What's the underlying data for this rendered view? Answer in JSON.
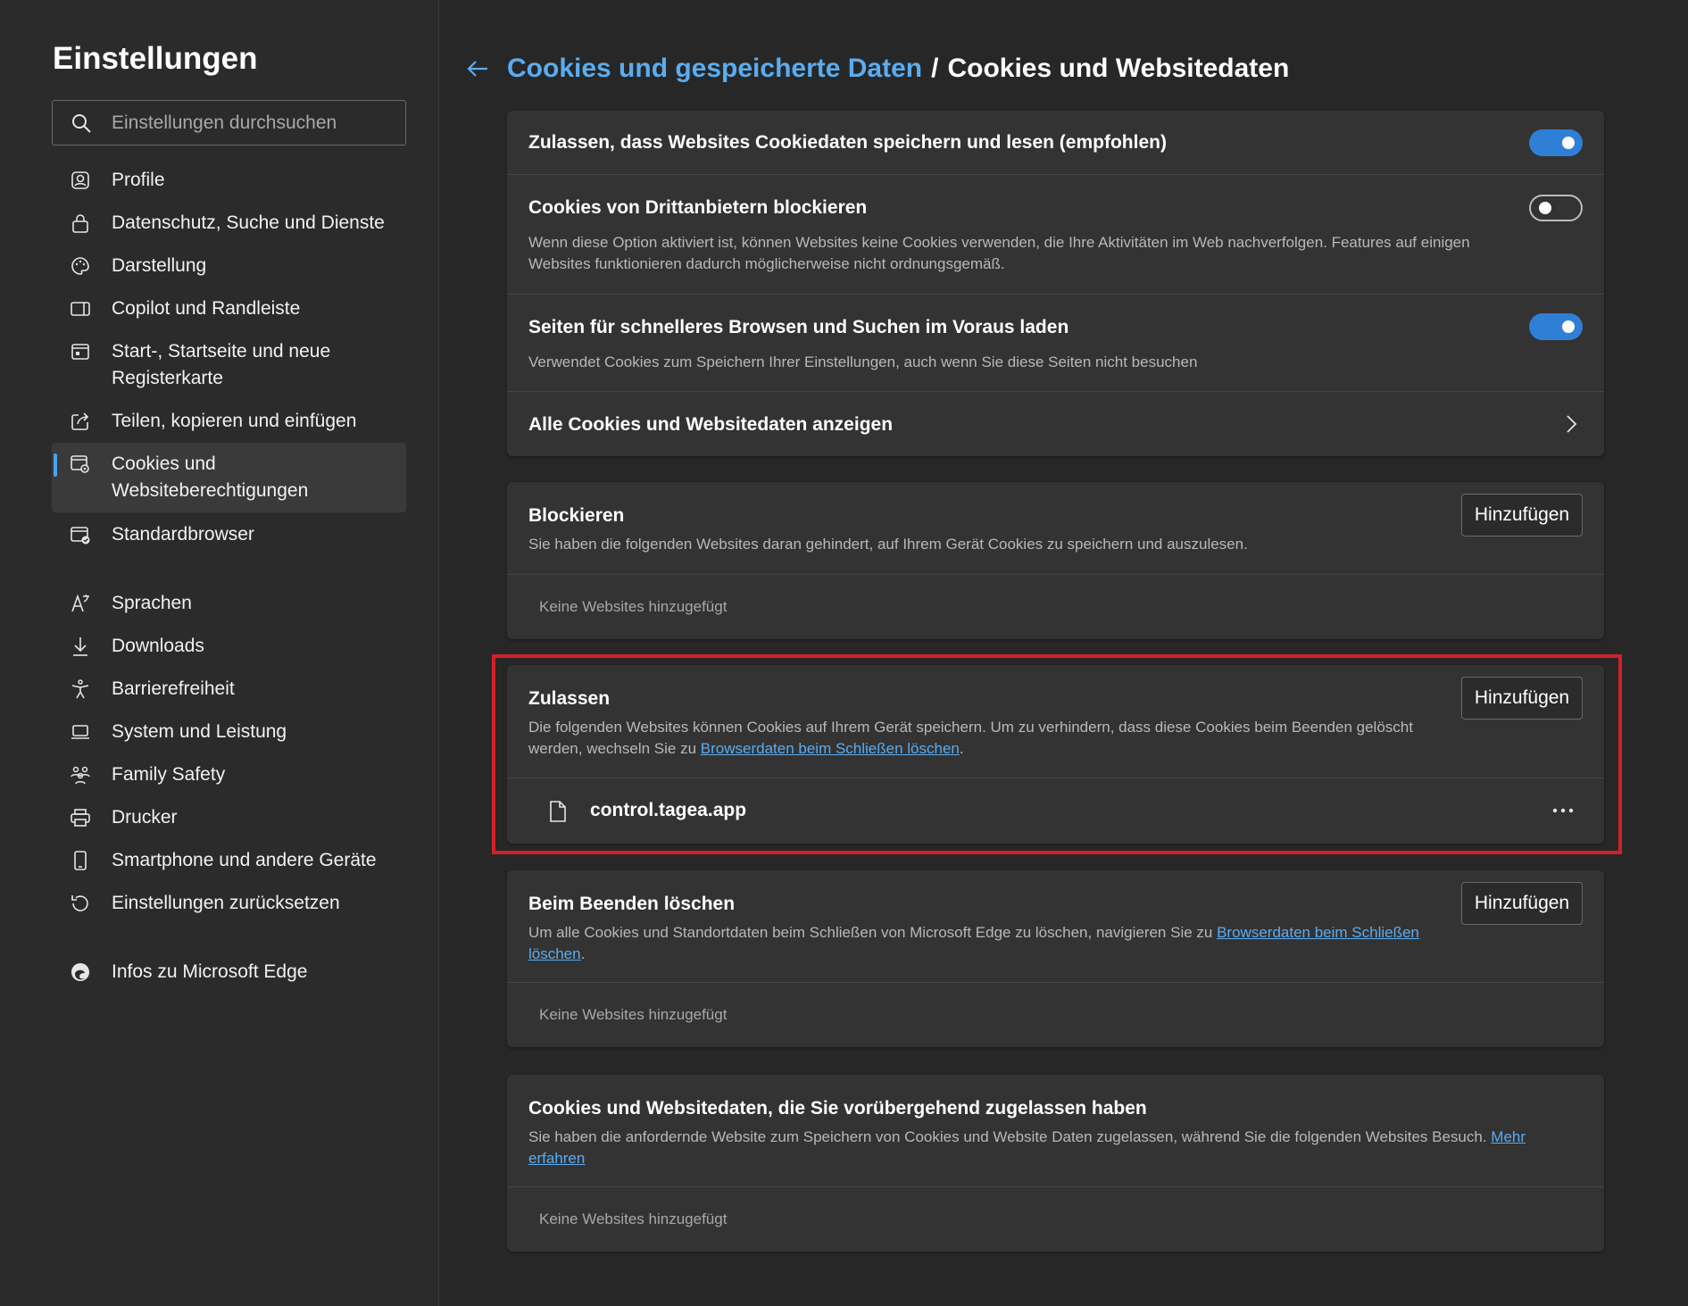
{
  "sidebar": {
    "title": "Einstellungen",
    "search_placeholder": "Einstellungen durchsuchen",
    "items": [
      {
        "label": "Profile",
        "icon": "profile-icon"
      },
      {
        "label": "Datenschutz, Suche und Dienste",
        "icon": "lock-icon"
      },
      {
        "label": "Darstellung",
        "icon": "palette-icon"
      },
      {
        "label": "Copilot und Randleiste",
        "icon": "sidebar-icon"
      },
      {
        "label": "Start-, Startseite und neue Registerkarte",
        "icon": "home-tab-icon"
      },
      {
        "label": "Teilen, kopieren und einfügen",
        "icon": "share-icon"
      },
      {
        "label": "Cookies und Websiteberechtigungen",
        "icon": "cookies-icon",
        "active": true
      },
      {
        "label": "Standardbrowser",
        "icon": "default-browser-icon"
      },
      {
        "label": "Sprachen",
        "icon": "languages-icon"
      },
      {
        "label": "Downloads",
        "icon": "download-icon"
      },
      {
        "label": "Barrierefreiheit",
        "icon": "accessibility-icon"
      },
      {
        "label": "System und Leistung",
        "icon": "laptop-icon"
      },
      {
        "label": "Family Safety",
        "icon": "family-icon"
      },
      {
        "label": "Drucker",
        "icon": "printer-icon"
      },
      {
        "label": "Smartphone und andere Geräte",
        "icon": "phone-icon"
      },
      {
        "label": "Einstellungen zurücksetzen",
        "icon": "reset-icon"
      },
      {
        "label": "Infos zu Microsoft Edge",
        "icon": "edge-logo-icon"
      }
    ]
  },
  "header": {
    "parent": "Cookies und gespeicherte Daten",
    "separator": "/",
    "current": "Cookies und Websitedaten"
  },
  "settings": {
    "allow_cookies": {
      "title": "Zulassen, dass Websites Cookiedaten speichern und lesen (empfohlen)",
      "enabled": true
    },
    "block_third_party": {
      "title": "Cookies von Drittanbietern blockieren",
      "desc_line1": "Wenn diese Option aktiviert ist, können Websites keine Cookies verwenden, die Ihre Aktivitäten im Web nachverfolgen. Features auf einigen",
      "desc_line2": "Websites funktionieren dadurch möglicherweise nicht ordnungsgemäß.",
      "enabled": false
    },
    "preload": {
      "title": "Seiten für schnelleres Browsen und Suchen im Voraus laden",
      "desc": "Verwendet Cookies zum Speichern Ihrer Einstellungen, auch wenn Sie diese Seiten nicht besuchen",
      "enabled": true
    },
    "show_all": {
      "title": "Alle Cookies und Websitedaten anzeigen"
    }
  },
  "block": {
    "title": "Blockieren",
    "desc": "Sie haben die folgenden Websites daran gehindert, auf Ihrem Gerät Cookies zu speichern und auszulesen.",
    "button": "Hinzufügen",
    "empty": "Keine Websites hinzugefügt"
  },
  "allow": {
    "title": "Zulassen",
    "desc_line1": "Die folgenden Websites können Cookies auf Ihrem Gerät speichern. Um zu verhindern, dass diese Cookies beim Beenden gelöscht",
    "desc_line2_pre": "werden, wechseln Sie zu ",
    "desc_link": "Browserdaten beim Schließen löschen",
    "desc_line2_post": ".",
    "button": "Hinzufügen",
    "sites": [
      {
        "name": "control.tagea.app"
      }
    ]
  },
  "clear_on_exit": {
    "title": "Beim Beenden löschen",
    "desc_line1_pre": "Um alle Cookies und Standortdaten beim Schließen von Microsoft Edge zu löschen, navigieren Sie zu ",
    "desc_link_part1": "Browserdaten beim Schließen",
    "desc_link_part2": "löschen",
    "desc_post": ".",
    "button": "Hinzufügen",
    "empty": "Keine Websites hinzugefügt"
  },
  "temporary": {
    "title": "Cookies und Websitedaten, die Sie vorübergehend zugelassen haben",
    "desc_line1_pre": "Sie haben die anfordernde Website zum Speichern von Cookies und Website Daten zugelassen, während Sie die folgenden Websites Besuch. ",
    "desc_link_part1": "Mehr",
    "desc_link_part2": "erfahren",
    "empty": "Keine Websites hinzugefügt"
  },
  "colors": {
    "accent": "#5aacf0",
    "toggle_on": "#2f7fd6",
    "highlight": "#d41f2a"
  }
}
